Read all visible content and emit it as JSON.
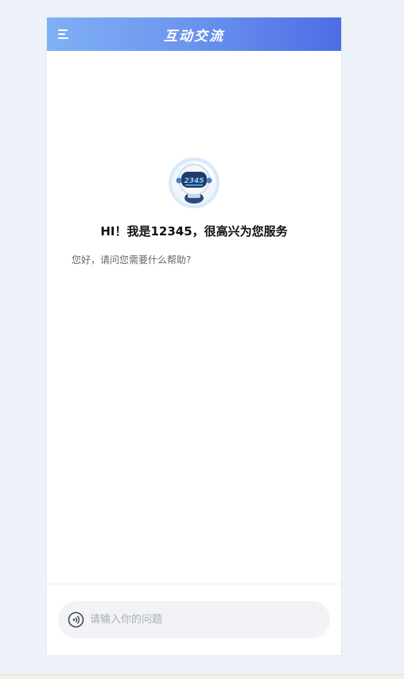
{
  "header": {
    "title": "互动交流",
    "menu_icon": "menu-icon"
  },
  "bot": {
    "avatar_icon": "robot-avatar-icon",
    "avatar_label": "2345",
    "greeting": "HI！我是12345，很高兴为您服务",
    "message": "您好，请问您需要什么帮助?"
  },
  "composer": {
    "voice_icon": "voice-icon",
    "placeholder": "请输入你的问题",
    "value": ""
  },
  "colors": {
    "header_gradient_start": "#7fb0f5",
    "header_gradient_end": "#4c6de6",
    "background": "#edf1f8",
    "input_bg": "#f2f3f6"
  }
}
